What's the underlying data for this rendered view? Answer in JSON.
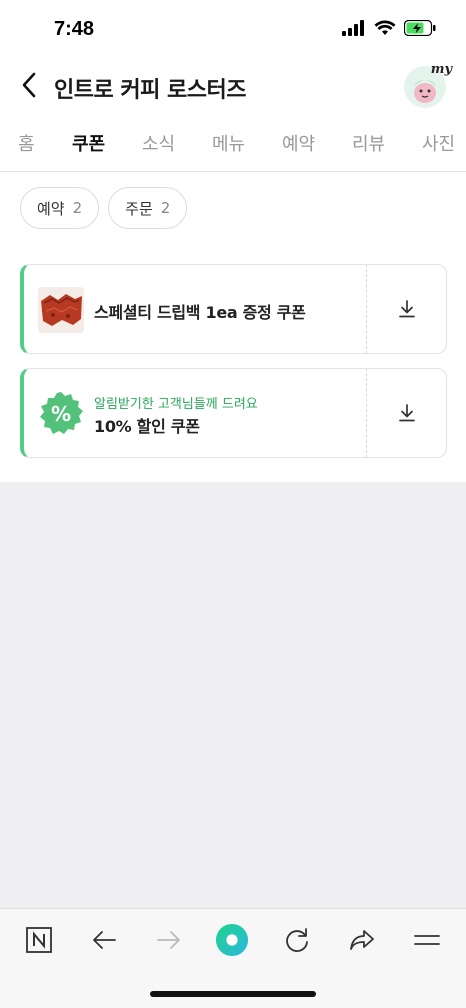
{
  "status": {
    "time": "7:48"
  },
  "header": {
    "title": "인트로 커피 로스터즈",
    "avatar_badge": "my"
  },
  "tabs": [
    {
      "label": "홈"
    },
    {
      "label": "쿠폰"
    },
    {
      "label": "소식"
    },
    {
      "label": "메뉴"
    },
    {
      "label": "예약"
    },
    {
      "label": "리뷰"
    },
    {
      "label": "사진"
    }
  ],
  "filters": [
    {
      "label": "예약",
      "count": "2"
    },
    {
      "label": "주문",
      "count": "2"
    }
  ],
  "coupons": [
    {
      "title": "스페셜티 드립백 1ea 증정 쿠폰",
      "subtitle": ""
    },
    {
      "title": "10% 할인 쿠폰",
      "subtitle": "알림받기한 고객님들께 드려요",
      "badge": "%"
    }
  ],
  "colors": {
    "accent": "#4fcf86",
    "accent_text": "#29a85a"
  },
  "icons": [
    "back-arrow-icon",
    "download-icon",
    "naver-icon",
    "back-icon",
    "forward-icon",
    "home-green-dot-icon",
    "reload-icon",
    "share-icon",
    "menu-icon"
  ]
}
